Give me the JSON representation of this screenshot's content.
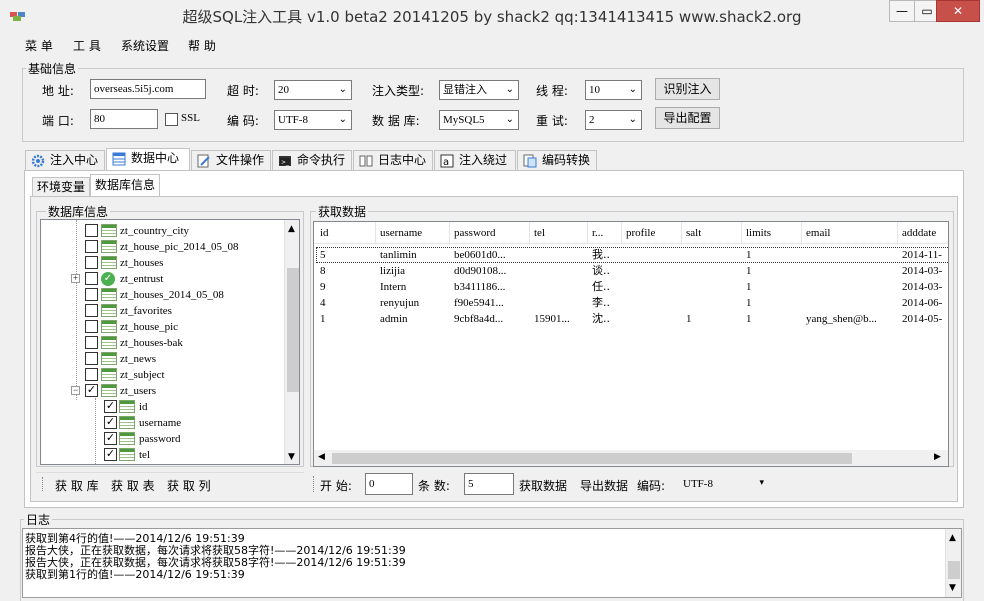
{
  "window": {
    "title": "超级SQL注入工具 v1.0 beta2 20141205 by shack2 qq:1341413415 www.shack2.org",
    "min": "—",
    "max": "▭",
    "close": "✕"
  },
  "menu": [
    "菜 单",
    "工 具",
    "系统设置",
    "帮 助"
  ],
  "basic": {
    "title": "基础信息",
    "addr_label": "地 址:",
    "addr_value": "overseas.5i5j.com",
    "port_label": "端 口:",
    "port_value": "80",
    "ssl_label": "SSL",
    "timeout_label": "超 时:",
    "timeout_value": "20",
    "encoding_label": "编 码:",
    "encoding_value": "UTF-8",
    "inject_type_label": "注入类型:",
    "inject_type_value": "显错注入",
    "db_label": "数 据 库:",
    "db_value": "MySQL5",
    "threads_label": "线 程:",
    "threads_value": "10",
    "retry_label": "重 试:",
    "retry_value": "2",
    "identify_btn": "识别注入",
    "export_btn": "导出配置"
  },
  "tabs": [
    "注入中心",
    "数据中心",
    "文件操作",
    "命令执行",
    "日志中心",
    "注入绕过",
    "编码转换"
  ],
  "subtabs": [
    "环境变量",
    "数据库信息"
  ],
  "dbinfo": {
    "title": "数据库信息",
    "tree": [
      {
        "name": "zt_country_city",
        "checked": false
      },
      {
        "name": "zt_house_pic_2014_05_08",
        "checked": false
      },
      {
        "name": "zt_houses",
        "checked": false
      },
      {
        "name": "zt_entrust",
        "checked": false,
        "status": "ok",
        "expand": "+"
      },
      {
        "name": "zt_houses_2014_05_08",
        "checked": false
      },
      {
        "name": "zt_favorites",
        "checked": false
      },
      {
        "name": "zt_house_pic",
        "checked": false
      },
      {
        "name": "zt_houses-bak",
        "checked": false
      },
      {
        "name": "zt_news",
        "checked": false
      },
      {
        "name": "zt_subject",
        "checked": false
      },
      {
        "name": "zt_users",
        "checked": true,
        "expand": "−"
      }
    ],
    "columns": [
      "id",
      "username",
      "password",
      "tel"
    ],
    "btn_db": "获 取 库",
    "btn_table": "获 取 表",
    "btn_col": "获 取 列"
  },
  "fetch": {
    "title": "获取数据",
    "headers": [
      "id",
      "username",
      "password",
      "tel",
      "r...",
      "profile",
      "salt",
      "limits",
      "email",
      "adddate"
    ],
    "rows": [
      [
        "5",
        "tanlimin",
        "be0601d0...",
        "",
        "我..",
        "",
        "",
        "1",
        "",
        "2014-11-"
      ],
      [
        "8",
        "lizijia",
        "d0d90108...",
        "",
        "谈..",
        "",
        "",
        "1",
        "",
        "2014-03-"
      ],
      [
        "9",
        "Intern",
        "b3411186...",
        "",
        "任..",
        "",
        "",
        "1",
        "",
        "2014-03-"
      ],
      [
        "4",
        "renyujun",
        "f90e5941...",
        "",
        "李..",
        "",
        "",
        "1",
        "",
        "2014-06-"
      ],
      [
        "1",
        "admin",
        "9cbf8a4d...",
        "15901...",
        "沈..",
        "",
        "1",
        "1",
        "yang_shen@b...",
        "2014-05-"
      ]
    ],
    "start_label": "开 始:",
    "start_value": "0",
    "count_label": "条 数:",
    "count_value": "5",
    "get_btn": "获取数据",
    "export_btn": "导出数据",
    "enc_label": "编码:",
    "enc_value": "UTF-8"
  },
  "log": {
    "title": "日志",
    "lines": [
      "获取到第4行的值!——2014/12/6 19:51:39",
      "报告大侠，正在获取数据，每次请求将获取58字符!——2014/12/6 19:51:39",
      "报告大侠，正在获取数据，每次请求将获取58字符!——2014/12/6 19:51:39",
      "获取到第1行的值!——2014/12/6 19:51:39"
    ]
  },
  "colors": {
    "accent": "#3399ff",
    "close": "#c7504a",
    "table_icon": "#4f9a3e"
  }
}
